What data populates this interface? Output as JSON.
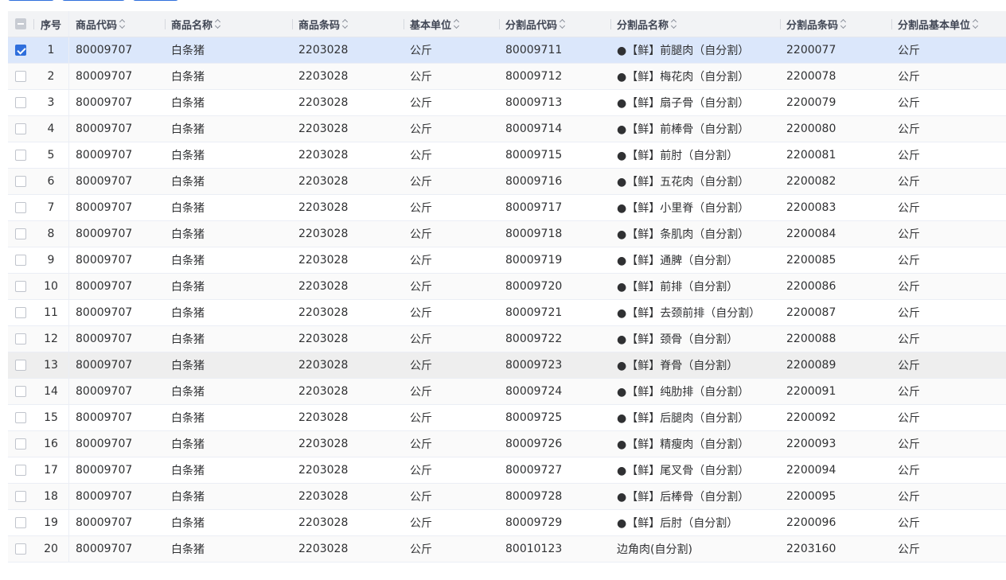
{
  "columns": {
    "index": "序号",
    "code": "商品代码",
    "name": "商品名称",
    "barcode": "商品条码",
    "unit": "基本单位",
    "split_code": "分割品代码",
    "split_name": "分割品名称",
    "split_barcode": "分割品条码",
    "split_unit": "分割品基本单位"
  },
  "rows": [
    {
      "idx": "1",
      "code": "80009707",
      "name": "白条猪",
      "barcode": "2203028",
      "unit": "公斤",
      "split_code": "80009711",
      "split_name": "●【鲜】前腿肉（自分割）",
      "split_barcode": "2200077",
      "split_unit": "公斤",
      "checked": true
    },
    {
      "idx": "2",
      "code": "80009707",
      "name": "白条猪",
      "barcode": "2203028",
      "unit": "公斤",
      "split_code": "80009712",
      "split_name": "●【鲜】梅花肉（自分割）",
      "split_barcode": "2200078",
      "split_unit": "公斤"
    },
    {
      "idx": "3",
      "code": "80009707",
      "name": "白条猪",
      "barcode": "2203028",
      "unit": "公斤",
      "split_code": "80009713",
      "split_name": "●【鲜】扇子骨（自分割）",
      "split_barcode": "2200079",
      "split_unit": "公斤"
    },
    {
      "idx": "4",
      "code": "80009707",
      "name": "白条猪",
      "barcode": "2203028",
      "unit": "公斤",
      "split_code": "80009714",
      "split_name": "●【鲜】前棒骨（自分割）",
      "split_barcode": "2200080",
      "split_unit": "公斤"
    },
    {
      "idx": "5",
      "code": "80009707",
      "name": "白条猪",
      "barcode": "2203028",
      "unit": "公斤",
      "split_code": "80009715",
      "split_name": "●【鲜】前肘（自分割）",
      "split_barcode": "2200081",
      "split_unit": "公斤"
    },
    {
      "idx": "6",
      "code": "80009707",
      "name": "白条猪",
      "barcode": "2203028",
      "unit": "公斤",
      "split_code": "80009716",
      "split_name": "●【鲜】五花肉（自分割）",
      "split_barcode": "2200082",
      "split_unit": "公斤"
    },
    {
      "idx": "7",
      "code": "80009707",
      "name": "白条猪",
      "barcode": "2203028",
      "unit": "公斤",
      "split_code": "80009717",
      "split_name": "●【鲜】小里脊（自分割）",
      "split_barcode": "2200083",
      "split_unit": "公斤"
    },
    {
      "idx": "8",
      "code": "80009707",
      "name": "白条猪",
      "barcode": "2203028",
      "unit": "公斤",
      "split_code": "80009718",
      "split_name": "●【鲜】条肌肉（自分割）",
      "split_barcode": "2200084",
      "split_unit": "公斤"
    },
    {
      "idx": "9",
      "code": "80009707",
      "name": "白条猪",
      "barcode": "2203028",
      "unit": "公斤",
      "split_code": "80009719",
      "split_name": "●【鲜】通脾（自分割）",
      "split_barcode": "2200085",
      "split_unit": "公斤"
    },
    {
      "idx": "10",
      "code": "80009707",
      "name": "白条猪",
      "barcode": "2203028",
      "unit": "公斤",
      "split_code": "80009720",
      "split_name": "●【鲜】前排（自分割）",
      "split_barcode": "2200086",
      "split_unit": "公斤"
    },
    {
      "idx": "11",
      "code": "80009707",
      "name": "白条猪",
      "barcode": "2203028",
      "unit": "公斤",
      "split_code": "80009721",
      "split_name": "●【鲜】去颈前排（自分割）",
      "split_barcode": "2200087",
      "split_unit": "公斤"
    },
    {
      "idx": "12",
      "code": "80009707",
      "name": "白条猪",
      "barcode": "2203028",
      "unit": "公斤",
      "split_code": "80009722",
      "split_name": "●【鲜】颈骨（自分割）",
      "split_barcode": "2200088",
      "split_unit": "公斤"
    },
    {
      "idx": "13",
      "code": "80009707",
      "name": "白条猪",
      "barcode": "2203028",
      "unit": "公斤",
      "split_code": "80009723",
      "split_name": "●【鲜】脊骨（自分割）",
      "split_barcode": "2200089",
      "split_unit": "公斤"
    },
    {
      "idx": "14",
      "code": "80009707",
      "name": "白条猪",
      "barcode": "2203028",
      "unit": "公斤",
      "split_code": "80009724",
      "split_name": "●【鲜】纯肋排（自分割）",
      "split_barcode": "2200091",
      "split_unit": "公斤"
    },
    {
      "idx": "15",
      "code": "80009707",
      "name": "白条猪",
      "barcode": "2203028",
      "unit": "公斤",
      "split_code": "80009725",
      "split_name": "●【鲜】后腿肉（自分割）",
      "split_barcode": "2200092",
      "split_unit": "公斤"
    },
    {
      "idx": "16",
      "code": "80009707",
      "name": "白条猪",
      "barcode": "2203028",
      "unit": "公斤",
      "split_code": "80009726",
      "split_name": "●【鲜】精瘦肉（自分割）",
      "split_barcode": "2200093",
      "split_unit": "公斤"
    },
    {
      "idx": "17",
      "code": "80009707",
      "name": "白条猪",
      "barcode": "2203028",
      "unit": "公斤",
      "split_code": "80009727",
      "split_name": "●【鲜】尾叉骨（自分割）",
      "split_barcode": "2200094",
      "split_unit": "公斤"
    },
    {
      "idx": "18",
      "code": "80009707",
      "name": "白条猪",
      "barcode": "2203028",
      "unit": "公斤",
      "split_code": "80009728",
      "split_name": "●【鲜】后棒骨（自分割）",
      "split_barcode": "2200095",
      "split_unit": "公斤"
    },
    {
      "idx": "19",
      "code": "80009707",
      "name": "白条猪",
      "barcode": "2203028",
      "unit": "公斤",
      "split_code": "80009729",
      "split_name": "●【鲜】后肘（自分割）",
      "split_barcode": "2200096",
      "split_unit": "公斤"
    },
    {
      "idx": "20",
      "code": "80009707",
      "name": "白条猪",
      "barcode": "2203028",
      "unit": "公斤",
      "split_code": "80010123",
      "split_name": "边角肉(自分割)",
      "split_barcode": "2203160",
      "split_unit": "公斤"
    }
  ],
  "select_all": "indeterminate",
  "hovered_row": "13",
  "colors": {
    "accent": "#2f6fdc",
    "selected_row": "#dbe7fb",
    "header_bg": "#f2f3f5"
  }
}
